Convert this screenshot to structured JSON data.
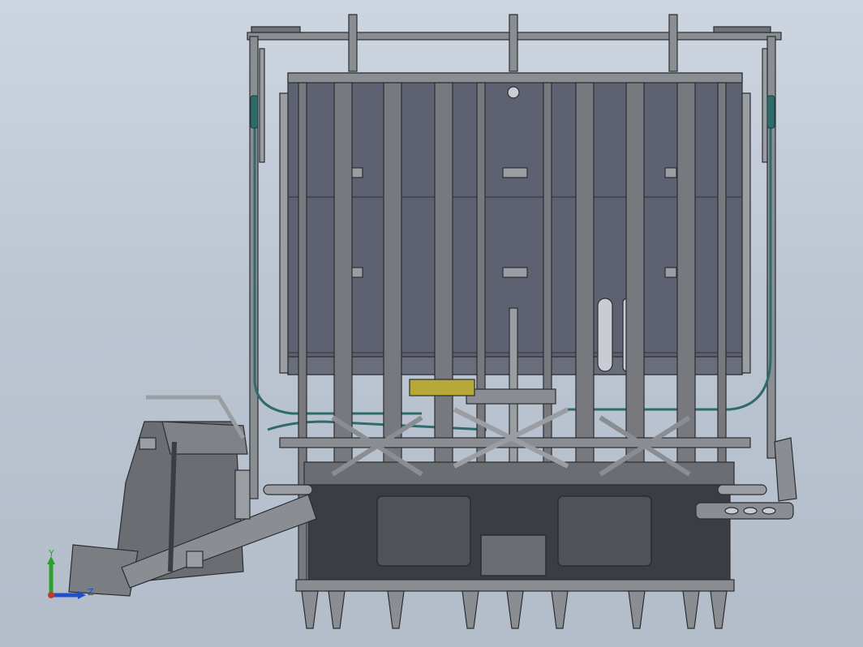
{
  "viewport": {
    "background_top": "#cdd5e0",
    "background_bottom": "#b3bdca"
  },
  "colors": {
    "frame_fill": "#7f8287",
    "frame_edge": "#2b2d31",
    "panel_fill": "#5e6171",
    "hose": "#2f6b6b",
    "tank": "#4f5257",
    "accent_yellow": "#b7a83a"
  },
  "triad": {
    "y_label": "Y",
    "z_label": "Z",
    "y_color": "#2ca02c",
    "z_color": "#2050c8",
    "origin_color": "#c0392b"
  }
}
